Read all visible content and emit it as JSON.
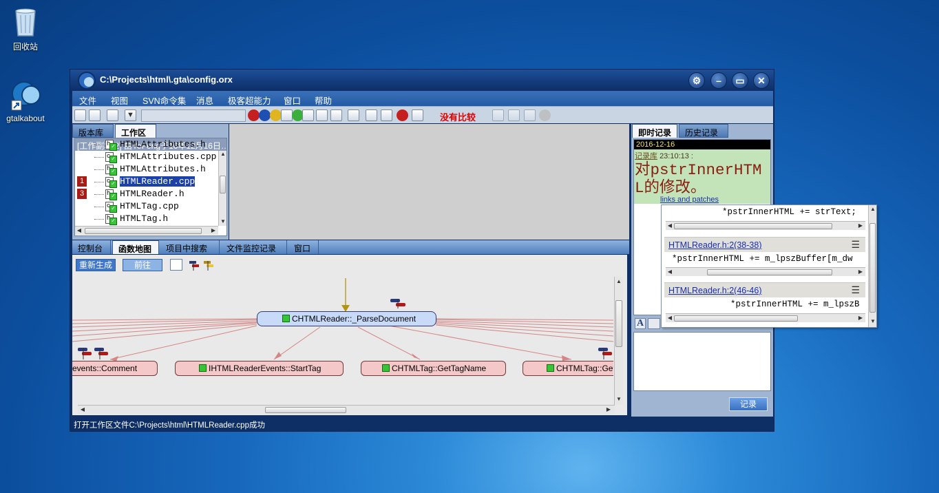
{
  "desktop": {
    "icons": [
      {
        "label": "回收站",
        "icon": "recycle-bin-icon"
      },
      {
        "label": "gtalkabout",
        "icon": "gtalk-shortcut-icon"
      }
    ]
  },
  "window": {
    "title": "C:\\Projects\\html\\.gta\\config.orx",
    "controls": [
      "settings",
      "minimize",
      "maximize",
      "close"
    ]
  },
  "menu": [
    "文件",
    "视图",
    "SVN命令集",
    "消息",
    "极客超能力",
    "窗口",
    "帮助"
  ],
  "toolbar": {
    "compare_status": "没有比较",
    "status_color": "#e00000"
  },
  "repo_tabs": [
    "版本库",
    "工作区"
  ],
  "tree": {
    "header": "[工作副本:2] 由YeFeng于16年12月16日…",
    "rows": [
      {
        "name": "HTMLAttributes.h",
        "type": "h",
        "badge": ""
      },
      {
        "name": "HTMLAttributes.cpp",
        "type": "c",
        "badge": ""
      },
      {
        "name": "HTMLAttributes.h",
        "type": "h",
        "badge": ""
      },
      {
        "name": "HTMLReader.cpp",
        "type": "c",
        "badge": "1"
      },
      {
        "name": "HTMLReader.h",
        "type": "h",
        "badge": "3"
      },
      {
        "name": "HTMLTag.cpp",
        "type": "c",
        "badge": ""
      },
      {
        "name": "HTMLTag.h",
        "type": "h",
        "badge": ""
      }
    ]
  },
  "bottom_tabs": [
    "控制台",
    "函数地图",
    "项目中搜索",
    "文件监控记录",
    "窗口"
  ],
  "graph": {
    "regenerate": "重新生成",
    "goto": "前往",
    "center_node": "CHTMLReader::_ParseDocument",
    "children": [
      "events::Comment",
      "IHTMLReaderEvents::StartTag",
      "CHTMLTag::GetTagName",
      "CHTMLTag::Get"
    ]
  },
  "records": {
    "tabs": [
      "即时记录",
      "历史记录"
    ],
    "date": "2016-12-16",
    "repo_label": "记录库",
    "time": "23:10:13 :",
    "message": "对pstrInnerHTML的修改。",
    "link": "links and patches",
    "submit": "记录"
  },
  "popup": {
    "first_line": "*pstrInnerHTML += strText;",
    "entries": [
      {
        "ref": "HTMLReader.h:2(38-38)",
        "code": "*pstrInnerHTML += m_lpszBuffer[m_dw"
      },
      {
        "ref": "HTMLReader.h:2(46-46)",
        "code": "*pstrInnerHTML += m_lpszB"
      }
    ]
  },
  "status": "打开工作区文件C:\\Projects\\html\\HTMLReader.cpp成功"
}
